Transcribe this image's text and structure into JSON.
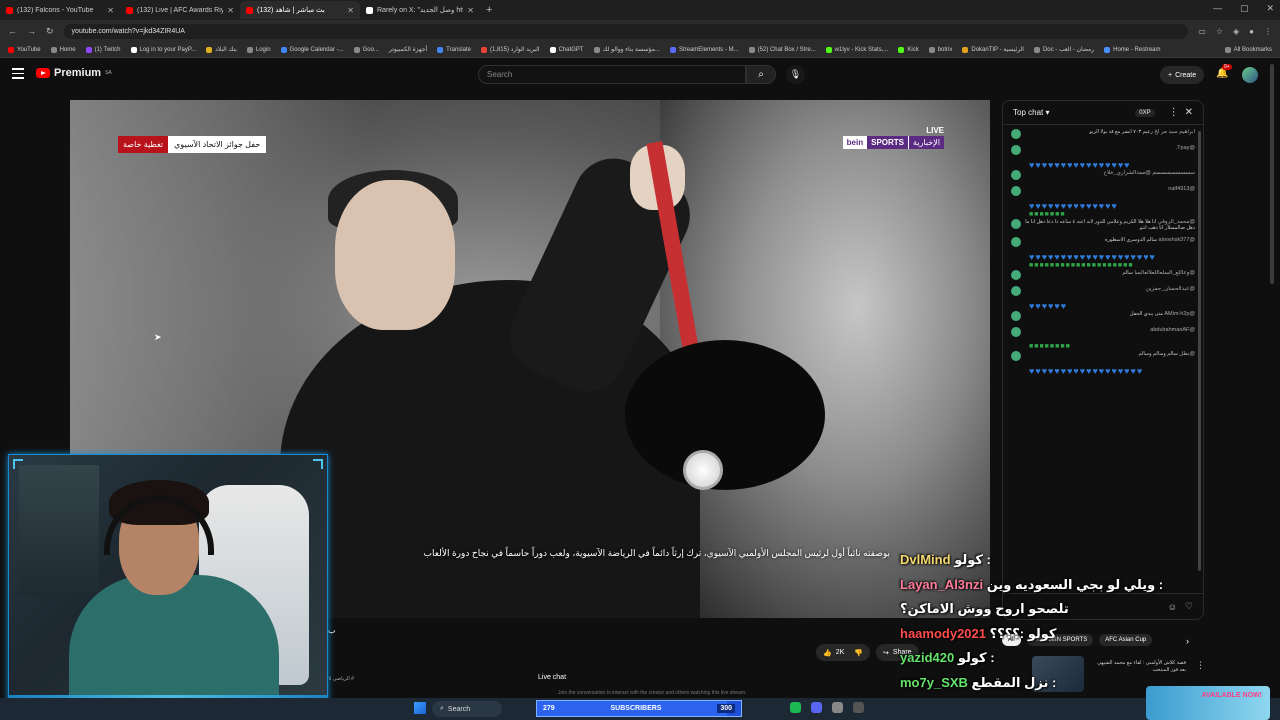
{
  "browser": {
    "tabs": [
      {
        "title": "(132) Falcons - YouTube",
        "active": false
      },
      {
        "title": "(132) Live | AFC Awards Riyadh",
        "active": false
      },
      {
        "title": "(132) بث مباشر | شاهد",
        "active": true
      },
      {
        "title": "Rarely on X: \"وصل الجديد https:",
        "active": false
      }
    ],
    "url": "youtube.com/watch?v=jkd34ZIR4UA",
    "bookmarks": [
      "YouTube",
      "Home",
      "(1) Twitch",
      "Log in to your PayP...",
      "بنك البلاد",
      "Login",
      "Google Calendar -...",
      "Goo...",
      "أجهزة الكمبيوتر",
      "Translate",
      "البريد الوارد (1,815)",
      "ChatGPT",
      "مؤسسة بناء ووالو لك...",
      "StreamElements - M...",
      "(52) Chat Box / Stre...",
      "w1lyv - Kick Stats,...",
      "Kick",
      "botrix",
      "DokanTIP - الرئيسية",
      "Doc - رمضان - العب",
      "Home - Restream"
    ],
    "all_bookmarks": "All Bookmarks"
  },
  "youtube": {
    "brand": "Premium",
    "brand_region": "SA",
    "search_placeholder": "Search",
    "create_label": "Create",
    "notif_count": "9+"
  },
  "video": {
    "live_label": "LIVE",
    "bein_logo": "bein",
    "bein_sports": "SPORTS",
    "bein_channel": "الإخبارية",
    "badge_red": "تغطية خاصة",
    "badge_white": "حفل جوائز الاتحاد الآسيوي",
    "subtitle": "بوصفته نائباً أول لرئيس المجلس الأولمبي الآسيوي، ترك إرثاً دائماً في الرياضة الآسيوية، ولعب دوراً حاسماً في نجاح دورة الألعاب",
    "channel_letter": "ب",
    "like_count": "2K",
    "share_label": "Share"
  },
  "chat": {
    "title": "Top chat",
    "xp": "0XP",
    "messages": [
      {
        "name": "ابراهيم سيد مر لخ",
        "text": "زعيم ٧٠٣ انشر مع قد بولا الزيو",
        "hearts": 0,
        "greens": 0
      },
      {
        "name": "@Tpay.",
        "text": "",
        "hearts": 16,
        "greens": 0
      },
      {
        "name": "سسسسسسسسم @ممدالشراري_خلاخ",
        "text": "",
        "hearts": 0,
        "greens": 0
      },
      {
        "name": "@nalf4913",
        "text": "",
        "hearts": 14,
        "greens": 7
      },
      {
        "name": "@محمد_الروقي",
        "text": "انا هلا هلا الكريم وعلامي للدور لانه اعنه ٤ ساعه دا دعا دهل انا ما دهل صالمسلار انا ذهب انتو",
        "hearts": 0,
        "greens": 0
      },
      {
        "name": "@alooshsk377",
        "text": "سالم الدوسري الاسطوره",
        "hearts": 20,
        "greens": 20
      },
      {
        "name": "@وعاللع_السلعاللعلالعالسا",
        "text": "سالم",
        "hearts": 0,
        "greens": 0
      },
      {
        "name": "@عبدالحسان_حمزين",
        "text": "",
        "hearts": 6,
        "greens": 0
      },
      {
        "name": "@AMim-h2p",
        "text": "متى يبدي الحفل",
        "hearts": 0,
        "greens": 0
      },
      {
        "name": "@abdulrahmanAF",
        "text": "",
        "hearts": 0,
        "greens": 8
      },
      {
        "name": "@بطل",
        "text": "سالم وسالم وسالم",
        "hearts": 18,
        "greens": 0
      }
    ]
  },
  "overlay_chat": [
    {
      "name": "DvlMind",
      "name_color": "#f5d76e",
      "text": "كولو :"
    },
    {
      "name": "Layan_Al3nzi",
      "name_color": "#ff7b9a",
      "text": "ويلي لو بجي السعوديه وين :"
    },
    {
      "name": "",
      "name_color": "#ffffff",
      "text": "تلصحو اروح ووش الاماكن؟"
    },
    {
      "name": "haamody2021",
      "name_color": "#ff4d4d",
      "text": "كولو :؟؟؟؟"
    },
    {
      "name": "yazid420",
      "name_color": "#66e36b",
      "text": "كولو :"
    },
    {
      "name": "mo7y_SXB",
      "name_color": "#66e36b",
      "text": "نزل المقطع :"
    }
  ],
  "chips": [
    "All",
    "From beIN SPORTS",
    "AFC Asian Cup"
  ],
  "below": {
    "live_chat_label": "Live chat",
    "join_chat": "Join the conversation to interact with the creator and others watching this live stream.",
    "footer_text": "الرياضي ٢٥ #"
  },
  "recommended": {
    "text": "قصة كلاش الأولمبي : لقاء مع محمد الشيهي بعد فوز المنتخب"
  },
  "taskbar": {
    "search_label": "Search",
    "subs_current": "279",
    "subs_label": "SUBSCRIBERS",
    "subs_goal": "300",
    "subs_progress": 0.93,
    "promo": "AVAILABLE NOW!"
  },
  "colors": {
    "accent_red": "#ff0000",
    "bein_purple": "#5b2b82",
    "heart_blue": "#2f7bdc",
    "webcam_border": "#1a8bd0"
  }
}
